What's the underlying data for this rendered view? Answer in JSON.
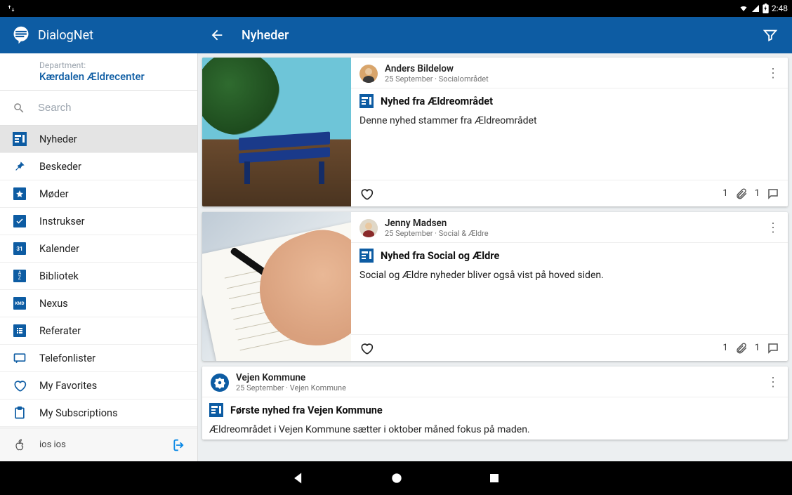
{
  "statusbar": {
    "time": "2:48"
  },
  "header": {
    "app_name": "DialogNet",
    "screen_title": "Nyheder"
  },
  "department": {
    "label": "Department:",
    "name": "Kærdalen Ældrecenter"
  },
  "search": {
    "placeholder": "Search"
  },
  "sidebar": {
    "items": [
      {
        "id": "news",
        "label": "Nyheder",
        "icon": "news",
        "active": true
      },
      {
        "id": "messages",
        "label": "Beskeder",
        "icon": "pin",
        "active": false
      },
      {
        "id": "meetings",
        "label": "Møder",
        "icon": "star",
        "active": false
      },
      {
        "id": "instructions",
        "label": "Instrukser",
        "icon": "check",
        "active": false
      },
      {
        "id": "calendar",
        "label": "Kalender",
        "icon": "cal31",
        "active": false
      },
      {
        "id": "library",
        "label": "Bibliotek",
        "icon": "az",
        "active": false
      },
      {
        "id": "nexus",
        "label": "Nexus",
        "icon": "kmd",
        "active": false
      },
      {
        "id": "minutes",
        "label": "Referater",
        "icon": "list",
        "active": false
      },
      {
        "id": "phonelists",
        "label": "Telefonlister",
        "icon": "chat",
        "active": false
      },
      {
        "id": "favorites",
        "label": "My Favorites",
        "icon": "heart",
        "active": false
      },
      {
        "id": "subscriptions",
        "label": "My Subscriptions",
        "icon": "clipboard",
        "active": false
      }
    ]
  },
  "footer": {
    "user": "ios ios"
  },
  "feed": {
    "posts": [
      {
        "author": "Anders Bildelow",
        "meta": "25 September · Socialområdet",
        "title": "Nyhed fra Ældreområdet",
        "text": "Denne nyhed stammer fra Ældreområdet",
        "attachments": "1",
        "comments": "1",
        "thumb": "bench"
      },
      {
        "author": "Jenny Madsen",
        "meta": "25 September · Social & Ældre",
        "title": "Nyhed fra Social og Ældre",
        "text": "Social og Ældre nyheder bliver også vist på hoved siden.",
        "attachments": "1",
        "comments": "1",
        "thumb": "notebook"
      },
      {
        "author": "Vejen Kommune",
        "meta": "25 September · Vejen Kommune",
        "title": "Første nyhed fra Vejen Kommune",
        "text": "Ældreområdet i Vejen Kommune sætter i oktober måned fokus på maden.",
        "attachments": "",
        "comments": "",
        "thumb": ""
      }
    ]
  }
}
